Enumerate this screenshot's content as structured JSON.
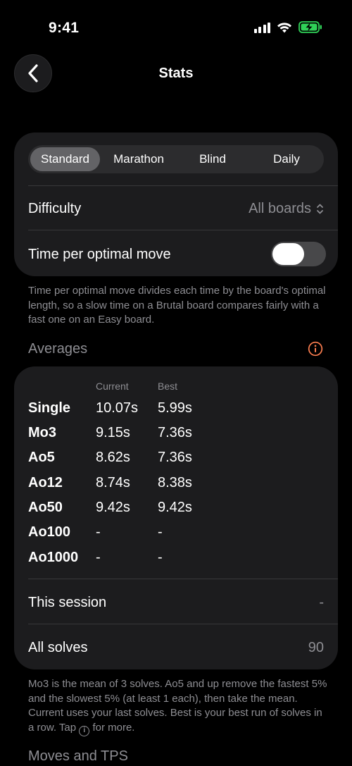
{
  "status_bar": {
    "time": "9:41"
  },
  "nav": {
    "title": "Stats"
  },
  "mode_tabs": [
    "Standard",
    "Marathon",
    "Blind",
    "Daily"
  ],
  "settings": {
    "difficulty_label": "Difficulty",
    "difficulty_value": "All boards",
    "time_per_move_label": "Time per optimal move",
    "time_per_move_enabled": false
  },
  "settings_note": "Time per optimal move divides each time by the board's optimal length, so a slow time on a Brutal board compares fairly with a fast one on an Easy board.",
  "averages": {
    "section_title": "Averages",
    "col_current": "Current",
    "col_best": "Best",
    "rows": [
      {
        "name": "Single",
        "current": "10.07s",
        "best": "5.99s"
      },
      {
        "name": "Mo3",
        "current": "9.15s",
        "best": "7.36s"
      },
      {
        "name": "Ao5",
        "current": "8.62s",
        "best": "7.36s"
      },
      {
        "name": "Ao12",
        "current": "8.74s",
        "best": "8.38s"
      },
      {
        "name": "Ao50",
        "current": "9.42s",
        "best": "9.42s"
      },
      {
        "name": "Ao100",
        "current": "-",
        "best": "-"
      },
      {
        "name": "Ao1000",
        "current": "-",
        "best": "-"
      }
    ],
    "this_session_label": "This session",
    "this_session_value": "-",
    "all_solves_label": "All solves",
    "all_solves_value": "90"
  },
  "averages_note_before": "Mo3 is the mean of 3 solves. Ao5 and up remove the fastest 5% and the slowest 5% (at least 1 each), then take the mean. Current uses your last solves. Best is your best run of solves in a row. Tap",
  "averages_note_after": "for more.",
  "next_section_title": "Moves and TPS",
  "colors": {
    "accent_info": "#ff7f50",
    "battery": "#30d158"
  }
}
